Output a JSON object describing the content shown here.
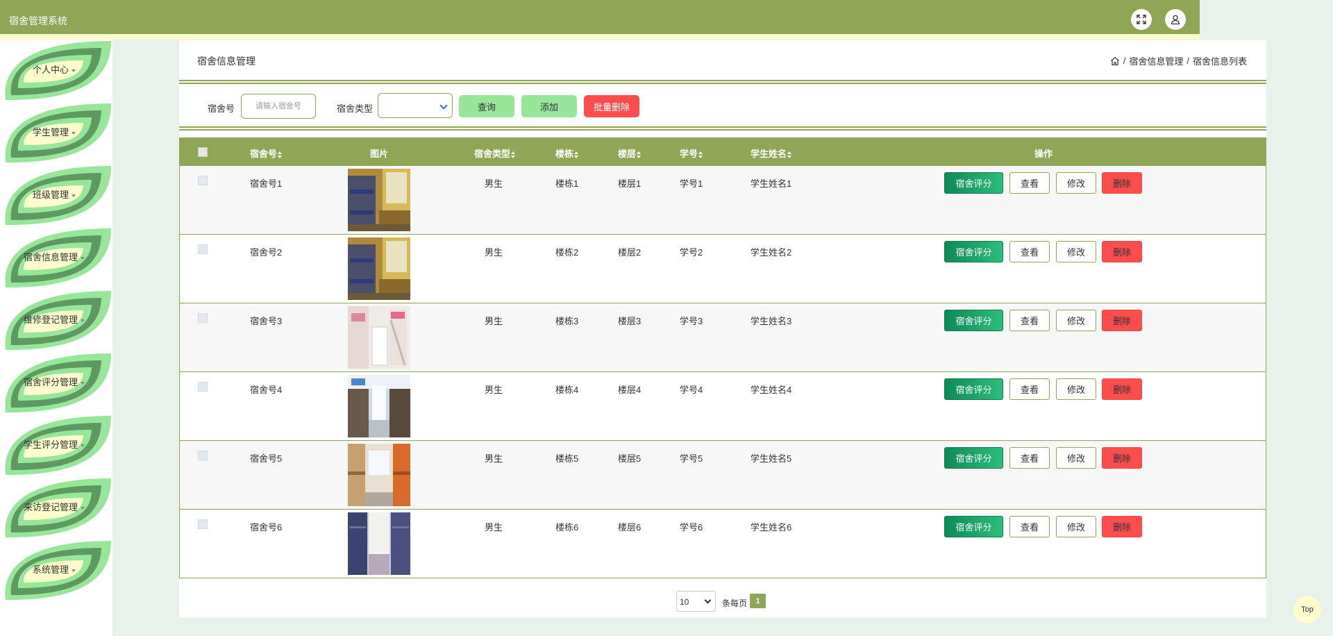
{
  "app": {
    "title": "宿舍管理系统"
  },
  "topbar": {
    "fullscreen_icon": "fullscreen-icon",
    "user_icon": "user-icon"
  },
  "sidebar": {
    "items": [
      {
        "label": "个人中心"
      },
      {
        "label": "学生管理"
      },
      {
        "label": "班级管理"
      },
      {
        "label": "宿舍信息管理"
      },
      {
        "label": "维修登记管理"
      },
      {
        "label": "宿舍评分管理"
      },
      {
        "label": "学生评分管理"
      },
      {
        "label": "来访登记管理"
      },
      {
        "label": "系统管理"
      }
    ]
  },
  "header": {
    "title": "宿舍信息管理",
    "breadcrumb": {
      "home_icon": "home-icon",
      "sep": "/",
      "level1": "宿舍信息管理",
      "level2": "宿舍信息列表"
    }
  },
  "search": {
    "dorm_no_label": "宿舍号",
    "dorm_no_placeholder": "请输入宿舍号",
    "dorm_type_label": "宿舍类型",
    "dorm_type_value": "",
    "query_button": "查询",
    "add_button": "添加",
    "batch_delete_button": "批量删除"
  },
  "table": {
    "columns": [
      "宿舍号",
      "图片",
      "宿舍类型",
      "楼栋",
      "楼层",
      "学号",
      "学生姓名",
      "操作"
    ],
    "rows": [
      {
        "dorm_no": "宿舍号1",
        "type": "男生",
        "building": "楼栋1",
        "floor": "楼层1",
        "student_no": "学号1",
        "student_name": "学生姓名1"
      },
      {
        "dorm_no": "宿舍号2",
        "type": "男生",
        "building": "楼栋2",
        "floor": "楼层2",
        "student_no": "学号2",
        "student_name": "学生姓名2"
      },
      {
        "dorm_no": "宿舍号3",
        "type": "男生",
        "building": "楼栋3",
        "floor": "楼层3",
        "student_no": "学号3",
        "student_name": "学生姓名3"
      },
      {
        "dorm_no": "宿舍号4",
        "type": "男生",
        "building": "楼栋4",
        "floor": "楼层4",
        "student_no": "学号4",
        "student_name": "学生姓名4"
      },
      {
        "dorm_no": "宿舍号5",
        "type": "男生",
        "building": "楼栋5",
        "floor": "楼层5",
        "student_no": "学号5",
        "student_name": "学生姓名5"
      },
      {
        "dorm_no": "宿舍号6",
        "type": "男生",
        "building": "楼栋6",
        "floor": "楼层6",
        "student_no": "学号6",
        "student_name": "学生姓名6"
      }
    ],
    "actions": {
      "score": "宿舍评分",
      "view": "查看",
      "edit": "修改",
      "delete": "删除"
    }
  },
  "pagination": {
    "page_size": "10",
    "per_page_text": "条每页",
    "current_page": "1"
  },
  "back_to_top": "Top",
  "colors": {
    "theme": "#8fa657",
    "strip": "#fdfccc",
    "leaf_light": "#98e69a",
    "leaf_dark": "#5c9a5f",
    "danger": "#ff4d4d",
    "score_green": "#0e8a57"
  }
}
